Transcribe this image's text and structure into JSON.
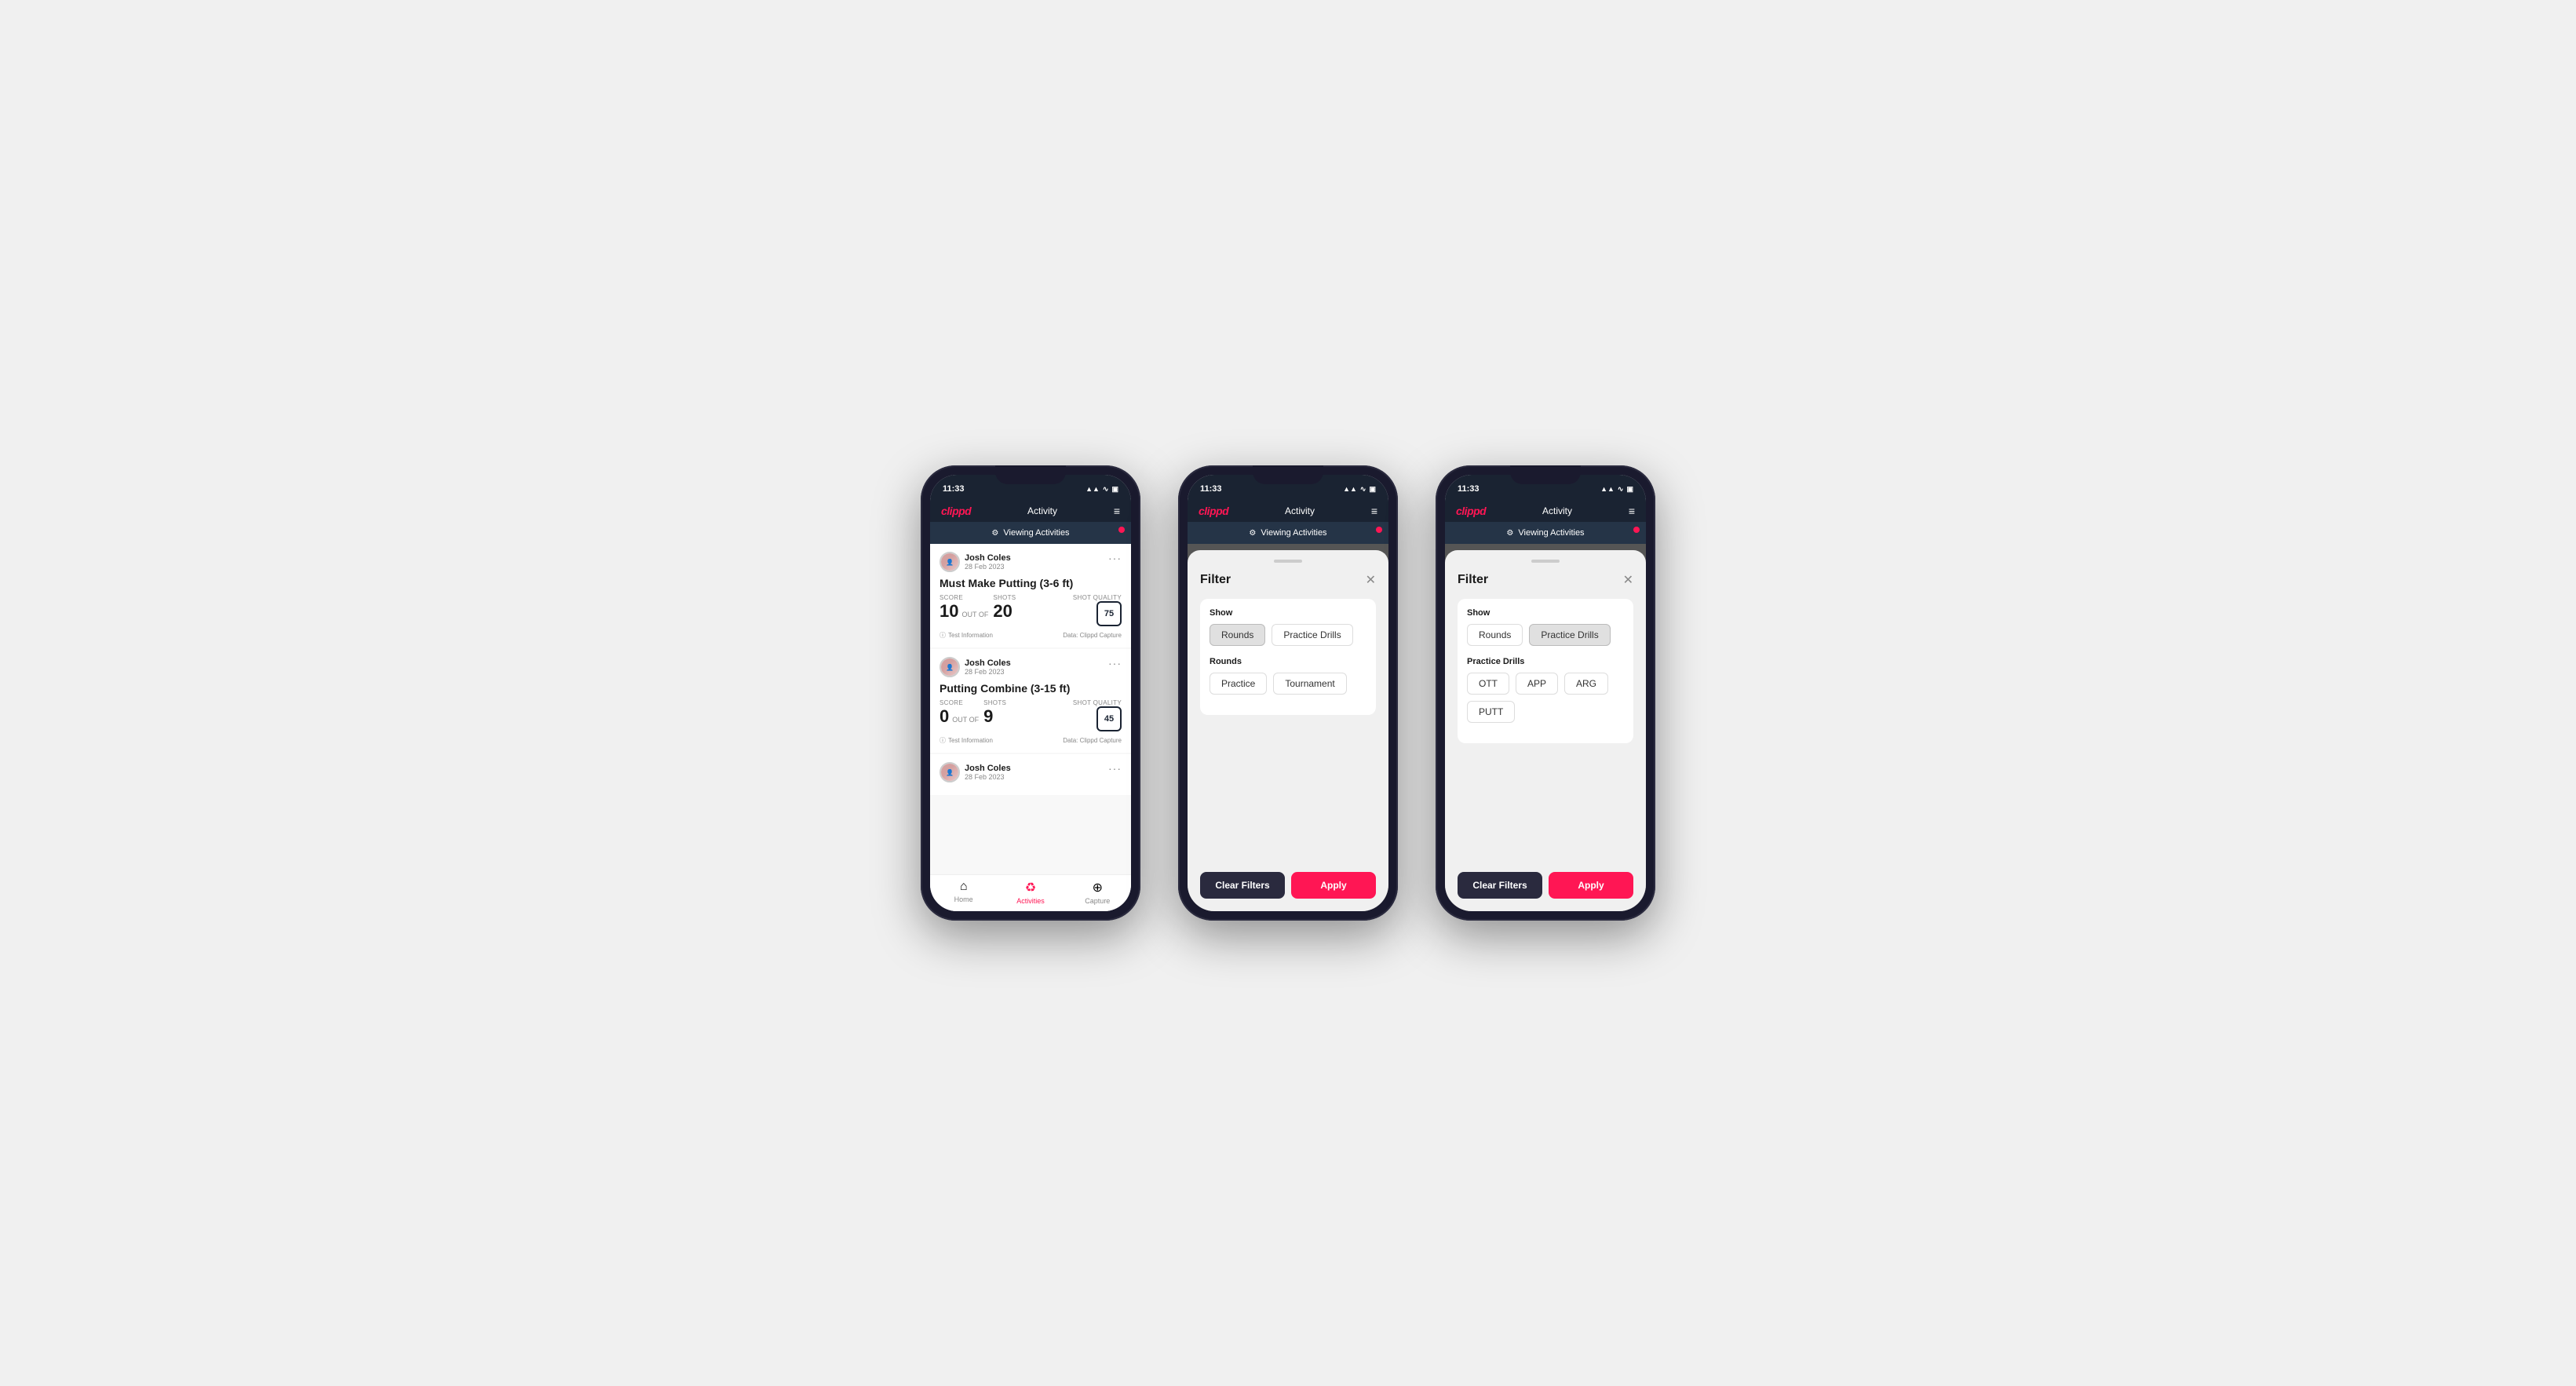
{
  "phones": [
    {
      "id": "phone1",
      "statusBar": {
        "time": "11:33",
        "icons": "▲ ▲ 51"
      },
      "header": {
        "logo": "clippd",
        "title": "Activity",
        "menuIcon": "≡"
      },
      "viewingBar": {
        "icon": "⚙",
        "text": "Viewing Activities"
      },
      "activities": [
        {
          "userName": "Josh Coles",
          "userDate": "28 Feb 2023",
          "title": "Must Make Putting (3-6 ft)",
          "scoreLabel": "Score",
          "scoreValue": "10",
          "outOfLabel": "OUT OF",
          "shotsLabel": "Shots",
          "shotsValue": "20",
          "shotQualityLabel": "Shot Quality",
          "shotQualityValue": "75",
          "testInfo": "Test Information",
          "dataSource": "Data: Clippd Capture"
        },
        {
          "userName": "Josh Coles",
          "userDate": "28 Feb 2023",
          "title": "Putting Combine (3-15 ft)",
          "scoreLabel": "Score",
          "scoreValue": "0",
          "outOfLabel": "OUT OF",
          "shotsLabel": "Shots",
          "shotsValue": "9",
          "shotQualityLabel": "Shot Quality",
          "shotQualityValue": "45",
          "testInfo": "Test Information",
          "dataSource": "Data: Clippd Capture"
        },
        {
          "userName": "Josh Coles",
          "userDate": "28 Feb 2023",
          "title": "",
          "scoreLabel": "",
          "scoreValue": "",
          "outOfLabel": "",
          "shotsLabel": "",
          "shotsValue": "",
          "shotQualityLabel": "",
          "shotQualityValue": "",
          "testInfo": "",
          "dataSource": ""
        }
      ],
      "nav": {
        "items": [
          {
            "icon": "⌂",
            "label": "Home",
            "active": false
          },
          {
            "icon": "♻",
            "label": "Activities",
            "active": true
          },
          {
            "icon": "⊕",
            "label": "Capture",
            "active": false
          }
        ]
      },
      "showFilter": false
    },
    {
      "id": "phone2",
      "statusBar": {
        "time": "11:33",
        "icons": "▲ ▲ 51"
      },
      "header": {
        "logo": "clippd",
        "title": "Activity",
        "menuIcon": "≡"
      },
      "viewingBar": {
        "icon": "⚙",
        "text": "Viewing Activities"
      },
      "showFilter": true,
      "filter": {
        "title": "Filter",
        "showLabel": "Show",
        "showButtons": [
          {
            "label": "Rounds",
            "active": true
          },
          {
            "label": "Practice Drills",
            "active": false
          }
        ],
        "roundsLabel": "Rounds",
        "roundButtons": [
          {
            "label": "Practice",
            "active": false
          },
          {
            "label": "Tournament",
            "active": false
          }
        ],
        "practiceDrillsLabel": "",
        "practiceButtons": [],
        "clearLabel": "Clear Filters",
        "applyLabel": "Apply"
      }
    },
    {
      "id": "phone3",
      "statusBar": {
        "time": "11:33",
        "icons": "▲ ▲ 51"
      },
      "header": {
        "logo": "clippd",
        "title": "Activity",
        "menuIcon": "≡"
      },
      "viewingBar": {
        "icon": "⚙",
        "text": "Viewing Activities"
      },
      "showFilter": true,
      "filter": {
        "title": "Filter",
        "showLabel": "Show",
        "showButtons": [
          {
            "label": "Rounds",
            "active": false
          },
          {
            "label": "Practice Drills",
            "active": true
          }
        ],
        "roundsLabel": "",
        "roundButtons": [],
        "practiceDrillsLabel": "Practice Drills",
        "practiceButtons": [
          {
            "label": "OTT",
            "active": false
          },
          {
            "label": "APP",
            "active": false
          },
          {
            "label": "ARG",
            "active": false
          },
          {
            "label": "PUTT",
            "active": false
          }
        ],
        "clearLabel": "Clear Filters",
        "applyLabel": "Apply"
      }
    }
  ]
}
